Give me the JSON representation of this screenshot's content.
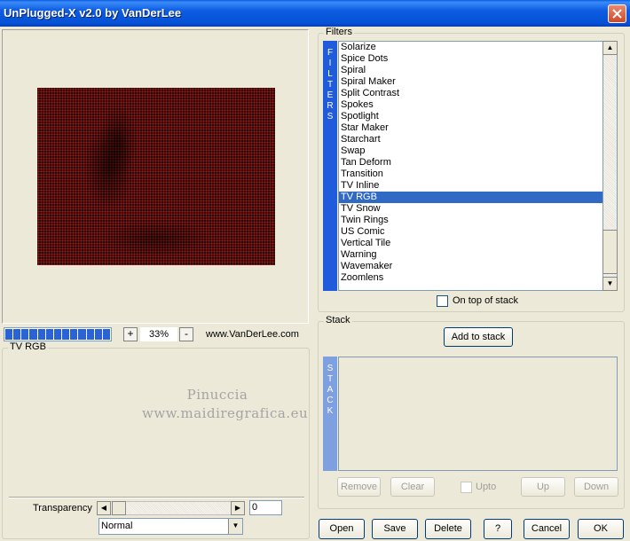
{
  "window": {
    "title": "UnPlugged-X v2.0 by VanDerLee"
  },
  "zoom": {
    "minus_label": "-",
    "plus_label": "+",
    "value": "33%",
    "progress": 1.0,
    "website": "www.VanDerLee.com"
  },
  "params": {
    "group_label": "TV RGB",
    "watermark_line1": "Pinuccia",
    "watermark_line2": "www.maidiregrafica.eu",
    "transparency_label": "Transparency",
    "transparency_value": "0",
    "blend_mode": "Normal"
  },
  "filters": {
    "group_label": "Filters",
    "tab_letters": [
      "F",
      "I",
      "L",
      "T",
      "E",
      "R",
      "S"
    ],
    "items": [
      "Solarize",
      "Spice Dots",
      "Spiral",
      "Spiral Maker",
      "Split Contrast",
      "Spokes",
      "Spotlight",
      "Star Maker",
      "Starchart",
      "Swap",
      "Tan Deform",
      "Transition",
      "TV Inline",
      "TV RGB",
      "TV Snow",
      "Twin Rings",
      "US Comic",
      "Vertical Tile",
      "Warning",
      "Wavemaker",
      "Zoomlens"
    ],
    "selected": "TV RGB",
    "on_top_label": "On top of stack"
  },
  "stack": {
    "group_label": "Stack",
    "add_label": "Add to stack",
    "tab_letters": [
      "S",
      "T",
      "A",
      "C",
      "K"
    ],
    "remove_label": "Remove",
    "clear_label": "Clear",
    "upto_label": "Upto",
    "up_label": "Up",
    "down_label": "Down"
  },
  "footer": {
    "open": "Open",
    "save": "Save",
    "delete": "Delete",
    "help": "?",
    "cancel": "Cancel",
    "ok": "OK"
  }
}
